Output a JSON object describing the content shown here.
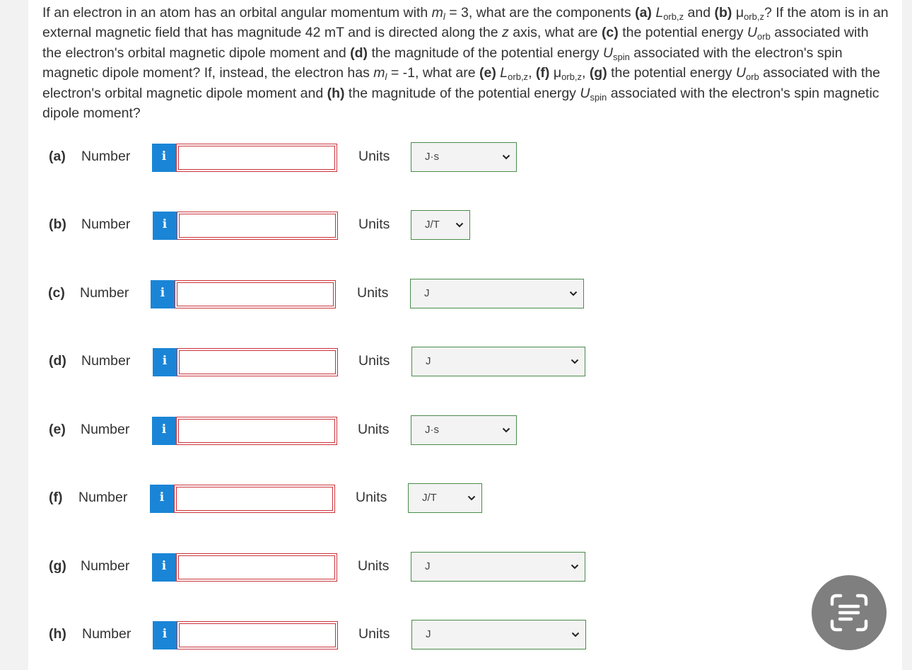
{
  "question": {
    "p1": "If an electron in an atom has an orbital angular momentum with ",
    "m_l": "m",
    "l_sub": "l",
    "p2": " = 3, what are the components ",
    "a": "(a)",
    "L1": "L",
    "orbz_1": "orb,z",
    "p3": " and ",
    "b": "(b)",
    "mu1": "μ",
    "orbz_2": "orb,z",
    "p4": "? If the atom is in an external magnetic field that has magnitude 42 mT and is directed along the ",
    "z": "z",
    "p5": " axis, what are ",
    "c": "(c)",
    "p6": " the potential energy ",
    "U1": "U",
    "orb_1": "orb",
    "p7": " associated with the electron's orbital magnetic dipole moment and ",
    "d": "(d)",
    "p8": " the magnitude of the potential energy ",
    "U2": "U",
    "spin_1": "spin",
    "p9": " associated with the electron's spin magnetic dipole moment? If, instead, the electron has ",
    "m_l2": "m",
    "l_sub2": "l",
    "p10": " = -1, what are ",
    "e": "(e)",
    "L2": "L",
    "orbz_3": "orb,z",
    "p11": ", ",
    "f": "(f)",
    "mu2": "μ",
    "orbz_4": "orb,z",
    "p12": ", ",
    "g": "(g)",
    "p13": " the potential energy ",
    "U3": "U",
    "orb_2": "orb",
    "p14": " associated with the electron's orbital magnetic dipole moment and ",
    "h": "(h)",
    "p15": " the magnitude of the potential energy ",
    "U4": "U",
    "spin_2": "spin",
    "p16": " associated with the electron's spin magnetic dipole moment?"
  },
  "number_label": "Number",
  "units_label": "Units",
  "info_icon": "i",
  "parts": [
    {
      "part": "(a)",
      "unit": "J·s"
    },
    {
      "part": "(b)",
      "unit": "J/T"
    },
    {
      "part": "(c)",
      "unit": "J"
    },
    {
      "part": "(d)",
      "unit": "J"
    },
    {
      "part": "(e)",
      "unit": "J·s"
    },
    {
      "part": "(f)",
      "unit": "J/T"
    },
    {
      "part": "(g)",
      "unit": "J"
    },
    {
      "part": "(h)",
      "unit": "J"
    }
  ],
  "colors": {
    "info_button": "#1a85d6",
    "input_border": "#c9323a",
    "select_border": "#4a8c4a",
    "fab": "#7f7f7f"
  },
  "fab_icon": "scan-text-icon"
}
